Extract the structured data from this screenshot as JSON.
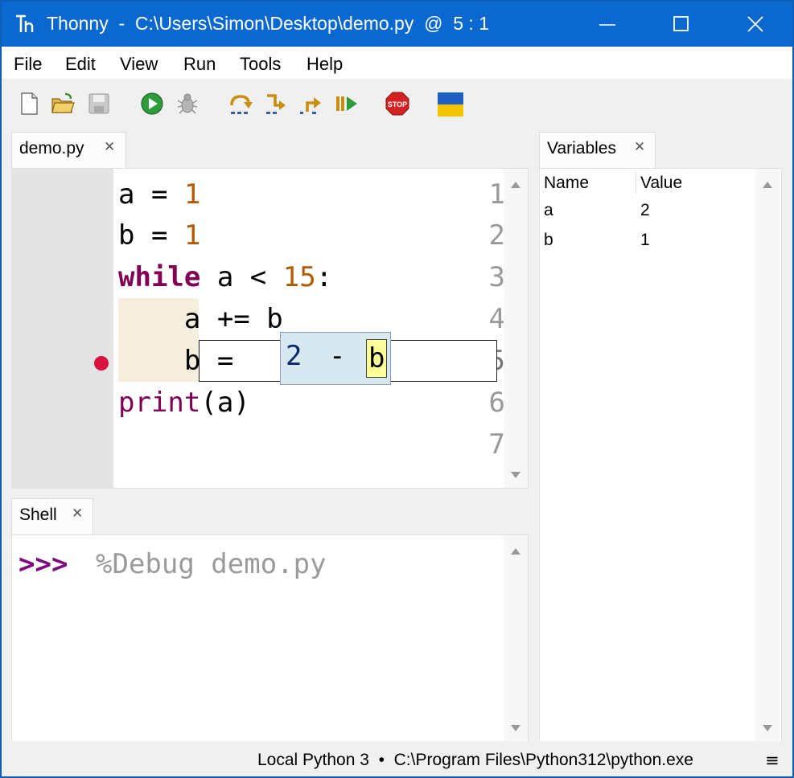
{
  "window": {
    "title": "Thonny  -  C:\\Users\\Simon\\Desktop\\demo.py  @  5 : 1"
  },
  "menu": [
    "File",
    "Edit",
    "View",
    "Run",
    "Tools",
    "Help"
  ],
  "toolbar": {
    "icons": [
      "new-file-icon",
      "open-file-icon",
      "save-icon",
      "run-icon",
      "debug-icon",
      "step-over-icon",
      "step-into-icon",
      "step-out-icon",
      "resume-icon",
      "stop-icon",
      "ukraine-flag-icon"
    ],
    "stop_label": "STOP"
  },
  "editor": {
    "tab_label": "demo.py",
    "lines": [
      {
        "n": "1",
        "text": "a = 1"
      },
      {
        "n": "2",
        "text": "b = 1"
      },
      {
        "n": "3",
        "text": "while a < 15:"
      },
      {
        "n": "4",
        "text": "    a += b"
      },
      {
        "n": "5",
        "text": "    b = a - b"
      },
      {
        "n": "6",
        "text": "print(a)"
      },
      {
        "n": "7",
        "text": ""
      }
    ],
    "breakpoint_line": "5",
    "eval_box": {
      "value": "2",
      "op": "-",
      "highlight": "b"
    }
  },
  "shell": {
    "tab_label": "Shell",
    "prompt": ">>>",
    "command": "%Debug demo.py"
  },
  "variables": {
    "tab_label": "Variables",
    "headers": [
      "Name",
      "Value"
    ],
    "rows": [
      {
        "name": "a",
        "value": "2"
      },
      {
        "name": "b",
        "value": "1"
      }
    ]
  },
  "status": {
    "text": "Local Python 3  •  C:\\Program Files\\Python312\\python.exe",
    "menu_glyph": "≡"
  },
  "colors": {
    "titlebar": "#0a68cf",
    "keyword": "#7f0055",
    "number": "#b35900",
    "breakpoint": "#d9123f",
    "highlight_box": "#d8e8f0",
    "highlight_var": "#ffff99",
    "indent_shade": "#f5eedc"
  }
}
